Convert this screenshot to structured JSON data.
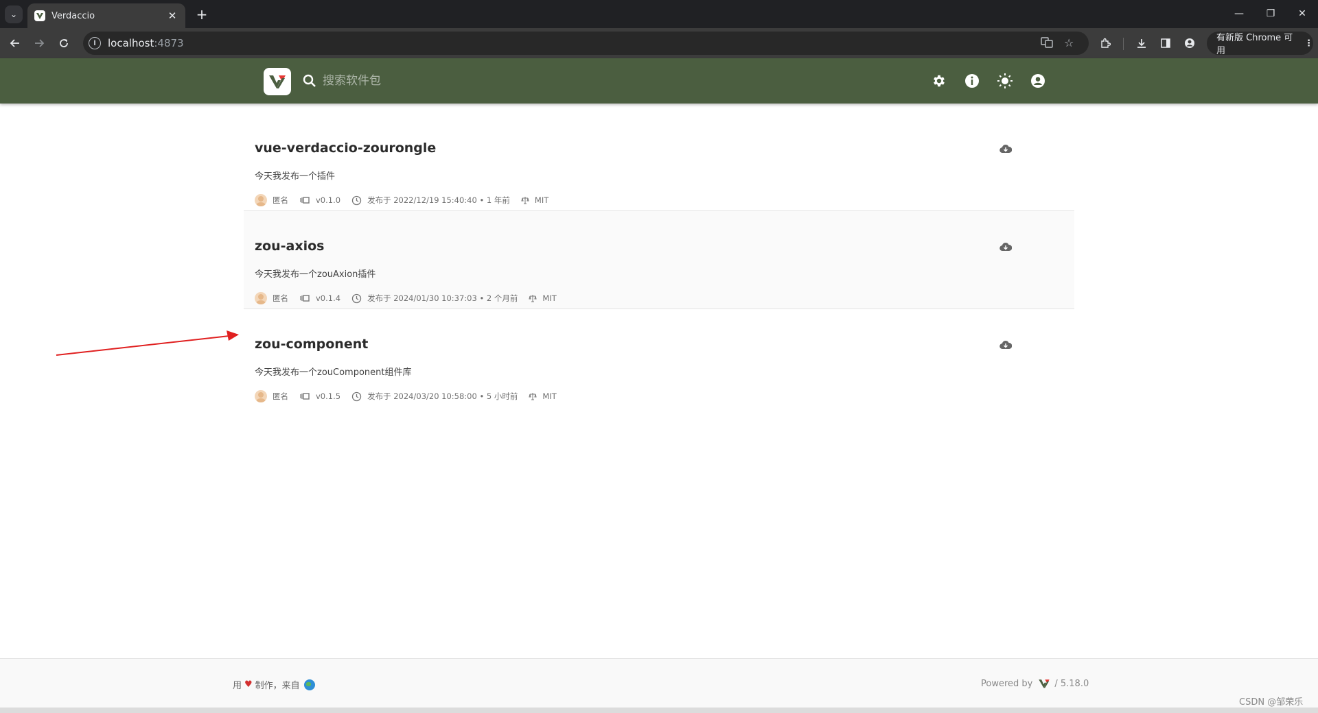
{
  "browser": {
    "tab_title": "Verdaccio",
    "url_host": "localhost",
    "url_port": ":4873",
    "update_label": "有新版 Chrome 可用"
  },
  "header": {
    "search_placeholder": "搜索软件包"
  },
  "packages": [
    {
      "name": "vue-verdaccio-zourongle",
      "description": "今天我发布一个插件",
      "author": "匿名",
      "version": "v0.1.0",
      "published": "发布于 2022/12/19 15:40:40 • 1 年前",
      "license": "MIT"
    },
    {
      "name": "zou-axios",
      "description": "今天我发布一个zouAxion插件",
      "author": "匿名",
      "version": "v0.1.4",
      "published": "发布于 2024/01/30 10:37:03 • 2 个月前",
      "license": "MIT"
    },
    {
      "name": "zou-component",
      "description": "今天我发布一个zouComponent组件库",
      "author": "匿名",
      "version": "v0.1.5",
      "published": "发布于 2024/03/20 10:58:00 • 5 小时前",
      "license": "MIT"
    }
  ],
  "footer": {
    "made_prefix": "用",
    "made_suffix": "制作，来自",
    "powered_by": "Powered by",
    "version": "/ 5.18.0"
  },
  "watermark": "CSDN @邹荣乐",
  "colors": {
    "header_bg": "#4b5e40",
    "annotation_arrow": "#e02020"
  }
}
